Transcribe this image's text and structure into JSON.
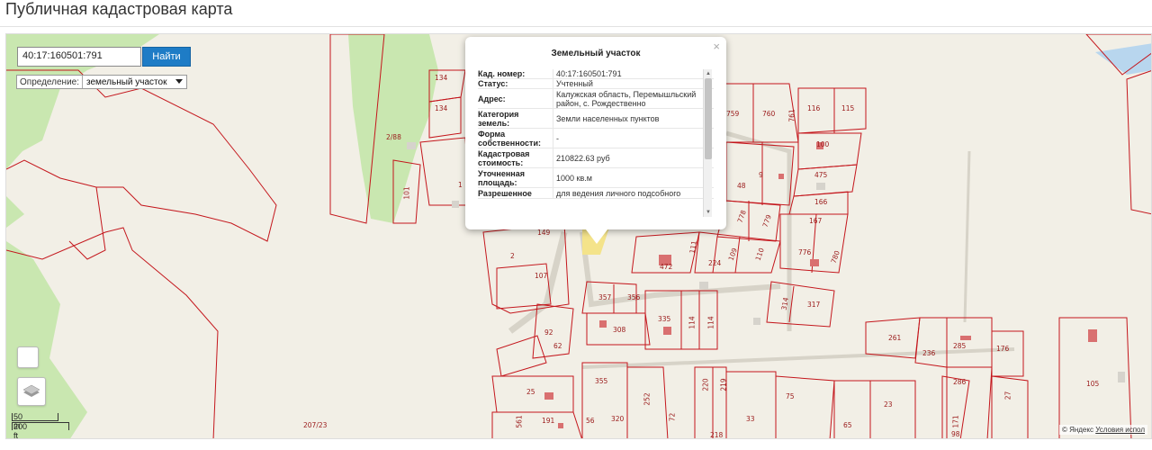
{
  "page_title": "Публичная кадастровая карта",
  "search": {
    "value": "40:17:160501:791",
    "button_label": "Найти"
  },
  "definition": {
    "label": "Определение:",
    "selected": "земельный участок"
  },
  "popup": {
    "title": "Земельный участок",
    "close_icon": "close-icon",
    "rows": [
      {
        "key": "Кад. номер:",
        "value": "40:17:160501:791"
      },
      {
        "key": "Статус:",
        "value": "Учтенный"
      },
      {
        "key": "Адрес:",
        "value": "Калужская область, Перемышльский район, с. Рождественно"
      },
      {
        "key": "Категория земель:",
        "value": "Земли населенных пунктов"
      },
      {
        "key": "Форма собственности:",
        "value": "-"
      },
      {
        "key": "Кадастровая стоимость:",
        "value": "210822.63 руб"
      },
      {
        "key": "Уточненная площадь:",
        "value": "1000 кв.м"
      },
      {
        "key": "Разрешенное",
        "value": "для ведения личного подсобного"
      }
    ]
  },
  "scale": {
    "metric": "50 m",
    "imperial": "200 ft"
  },
  "copyright": {
    "text": "© Яндекс",
    "link": "Условия испол"
  },
  "parcel_labels": [
    {
      "text": "134"
    },
    {
      "text": "134"
    },
    {
      "text": "2/88"
    },
    {
      "text": "101"
    },
    {
      "text": "759"
    },
    {
      "text": "760"
    },
    {
      "text": "761"
    },
    {
      "text": "116"
    },
    {
      "text": "115"
    },
    {
      "text": "100"
    },
    {
      "text": "9"
    },
    {
      "text": "48"
    },
    {
      "text": "475"
    },
    {
      "text": "166"
    },
    {
      "text": "167"
    },
    {
      "text": "778"
    },
    {
      "text": "779"
    },
    {
      "text": "149"
    },
    {
      "text": "2"
    },
    {
      "text": "107"
    },
    {
      "text": "776"
    },
    {
      "text": "780"
    },
    {
      "text": "472"
    },
    {
      "text": "224"
    },
    {
      "text": "109"
    },
    {
      "text": "110"
    },
    {
      "text": "111"
    },
    {
      "text": "357"
    },
    {
      "text": "356"
    },
    {
      "text": "314"
    },
    {
      "text": "317"
    },
    {
      "text": "92"
    },
    {
      "text": "62"
    },
    {
      "text": "308"
    },
    {
      "text": "335"
    },
    {
      "text": "114"
    },
    {
      "text": "114"
    },
    {
      "text": "261"
    },
    {
      "text": "236"
    },
    {
      "text": "285"
    },
    {
      "text": "176"
    },
    {
      "text": "25"
    },
    {
      "text": "355"
    },
    {
      "text": "220"
    },
    {
      "text": "219"
    },
    {
      "text": "75"
    },
    {
      "text": "286"
    },
    {
      "text": "27"
    },
    {
      "text": "105"
    },
    {
      "text": "23"
    },
    {
      "text": "191"
    },
    {
      "text": "56"
    },
    {
      "text": "320"
    },
    {
      "text": "72"
    },
    {
      "text": "33"
    },
    {
      "text": "65"
    },
    {
      "text": "218"
    },
    {
      "text": "171"
    },
    {
      "text": "98"
    },
    {
      "text": "207/23"
    },
    {
      "text": "561"
    },
    {
      "text": "252"
    },
    {
      "text": "1"
    }
  ],
  "colors": {
    "parcel_stroke": "#c4161c",
    "forest": "#c9e7b0",
    "map_bg": "#f2efe6",
    "button": "#1e7cc6"
  }
}
